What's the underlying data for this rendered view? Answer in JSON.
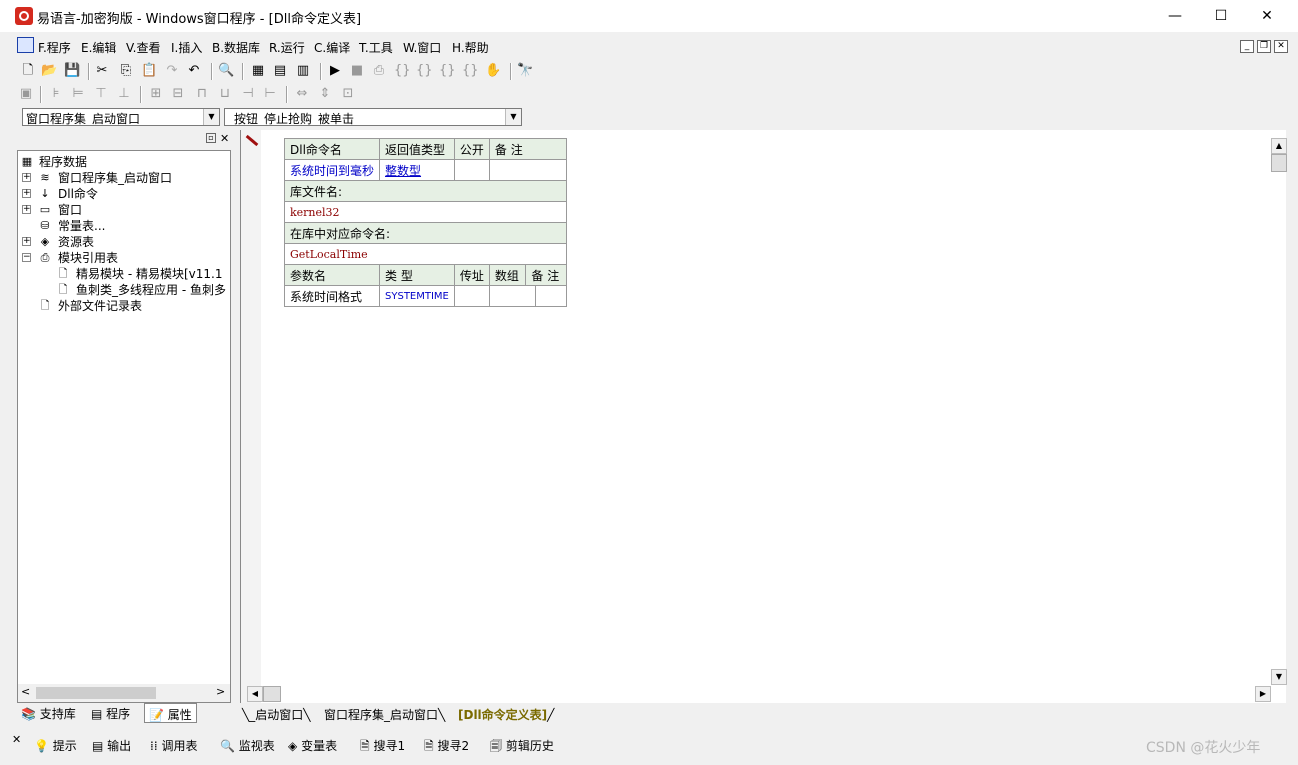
{
  "window": {
    "title": "易语言-加密狗版 - Windows窗口程序 - [Dll命令定义表]",
    "minimize": "—",
    "maximize": "☐",
    "close": "✕"
  },
  "menu": {
    "items": [
      "F.程序",
      "E.编辑",
      "V.查看",
      "I.插入",
      "B.数据库",
      "R.运行",
      "C.编译",
      "T.工具",
      "W.窗口",
      "H.帮助"
    ],
    "mdi_min": "_",
    "mdi_restore": "❐",
    "mdi_close": "✕"
  },
  "combos": {
    "left": "窗口程序集_启动窗口",
    "right": "_按钮_停止抢购_被单击"
  },
  "tree": {
    "root": "程序数据",
    "items": [
      {
        "label": "窗口程序集_启动窗口",
        "icon": "layers-icon"
      },
      {
        "label": "Dll命令",
        "icon": "dll-icon"
      },
      {
        "label": "窗口",
        "icon": "window-icon"
      },
      {
        "label": "常量表...",
        "icon": "constants-icon"
      },
      {
        "label": "资源表",
        "icon": "resource-icon"
      },
      {
        "label": "模块引用表",
        "icon": "module-icon"
      }
    ],
    "modules": [
      "精易模块 - 精易模块[v11.1",
      "鱼刺类_多线程应用 - 鱼刺多"
    ],
    "last": "外部文件记录表"
  },
  "dll_table": {
    "headers": [
      "Dll命令名",
      "返回值类型",
      "公开",
      "备 注"
    ],
    "name": "系统时间到毫秒",
    "return_type": "整数型",
    "lib_label": "库文件名:",
    "lib_value": "kernel32",
    "cmd_label": "在库中对应命令名:",
    "cmd_value": "GetLocalTime",
    "param_headers": [
      "参数名",
      "类 型",
      "传址",
      "数组",
      "备 注"
    ],
    "param_name": "系统时间格式",
    "param_type": "SYSTEMTIME"
  },
  "left_tabs": [
    "支持库",
    "程序",
    "属性"
  ],
  "editor_tabs": [
    "_启动窗口",
    "窗口程序集_启动窗口",
    "[Dll命令定义表]"
  ],
  "status_tabs": [
    "提示",
    "输出",
    "调用表",
    "监视表",
    "变量表",
    "搜寻1",
    "搜寻2",
    "剪辑历史"
  ],
  "watermark": "CSDN @花火少年",
  "colors": {
    "header_bg": "#e6f0e4",
    "type_blue": "#0000c8",
    "value_red": "#8b0000",
    "active_tab": "#7a6a00"
  }
}
